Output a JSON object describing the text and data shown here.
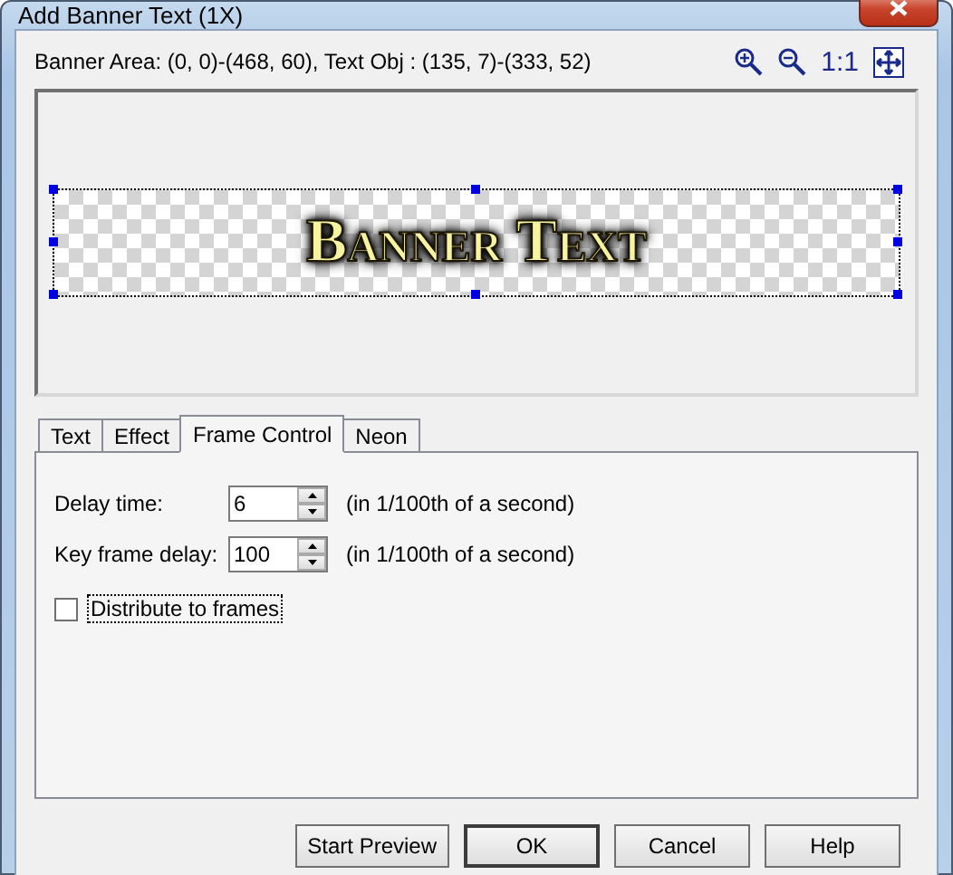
{
  "window": {
    "title": "Add Banner Text (1X)"
  },
  "info": "Banner Area: (0, 0)-(468, 60), Text Obj : (135, 7)-(333, 52)",
  "zoom_tools": [
    {
      "kind": "zoom-in"
    },
    {
      "kind": "zoom-out"
    },
    {
      "kind": "actual",
      "label": "1:1"
    },
    {
      "kind": "fit"
    }
  ],
  "banner": {
    "text": "Banner Text"
  },
  "tabs": [
    {
      "label": "Text",
      "selected": false
    },
    {
      "label": "Effect",
      "selected": false
    },
    {
      "label": "Frame Control",
      "selected": true
    },
    {
      "label": "Neon",
      "selected": false
    }
  ],
  "fields": [
    {
      "label": "Delay time:",
      "value": "6",
      "hint": "(in 1/100th of a second)"
    },
    {
      "label": "Key frame delay:",
      "value": "100",
      "hint": "(in 1/100th of a second)"
    }
  ],
  "distribute": {
    "label": "Distribute to frames",
    "checked": false
  },
  "buttons": [
    {
      "label": "Start Preview",
      "default": false
    },
    {
      "label": "OK",
      "default": true
    },
    {
      "label": "Cancel",
      "default": false
    },
    {
      "label": "Help",
      "default": false
    }
  ]
}
